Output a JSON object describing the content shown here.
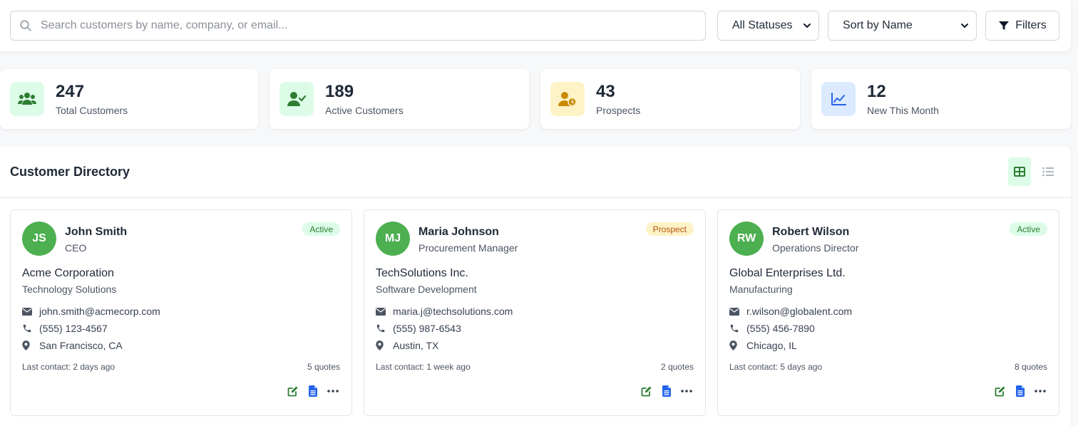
{
  "search": {
    "placeholder": "Search customers by name, company, or email..."
  },
  "filters": {
    "status_selected": "All Statuses",
    "sort_selected": "Sort by Name",
    "filters_label": "Filters"
  },
  "stats": [
    {
      "value": "247",
      "label": "Total Customers",
      "icon": "users-icon",
      "bg": "#dcfce7",
      "color": "#2e7d32"
    },
    {
      "value": "189",
      "label": "Active Customers",
      "icon": "user-check-icon",
      "bg": "#dcfce7",
      "color": "#2e7d32"
    },
    {
      "value": "43",
      "label": "Prospects",
      "icon": "user-clock-icon",
      "bg": "#fef3c7",
      "color": "#ca8a04"
    },
    {
      "value": "12",
      "label": "New This Month",
      "icon": "chart-line-icon",
      "bg": "#dbeafe",
      "color": "#2563eb"
    }
  ],
  "directory": {
    "title": "Customer Directory",
    "view": "grid",
    "customers": [
      {
        "initials": "JS",
        "name": "John Smith",
        "role": "CEO",
        "status": "Active",
        "company": "Acme Corporation",
        "industry": "Technology Solutions",
        "email": "john.smith@acmecorp.com",
        "phone": "(555) 123-4567",
        "location": "San Francisco, CA",
        "last_contact": "Last contact: 2 days ago",
        "quotes": "5 quotes"
      },
      {
        "initials": "MJ",
        "name": "Maria Johnson",
        "role": "Procurement Manager",
        "status": "Prospect",
        "company": "TechSolutions Inc.",
        "industry": "Software Development",
        "email": "maria.j@techsolutions.com",
        "phone": "(555) 987-6543",
        "location": "Austin, TX",
        "last_contact": "Last contact: 1 week ago",
        "quotes": "2 quotes"
      },
      {
        "initials": "RW",
        "name": "Robert Wilson",
        "role": "Operations Director",
        "status": "Active",
        "company": "Global Enterprises Ltd.",
        "industry": "Manufacturing",
        "email": "r.wilson@globalent.com",
        "phone": "(555) 456-7890",
        "location": "Chicago, IL",
        "last_contact": "Last contact: 5 days ago",
        "quotes": "8 quotes"
      }
    ]
  },
  "colors": {
    "accent": "#4caf50",
    "accent_dark": "#2e7d32",
    "blue": "#2563eb"
  }
}
